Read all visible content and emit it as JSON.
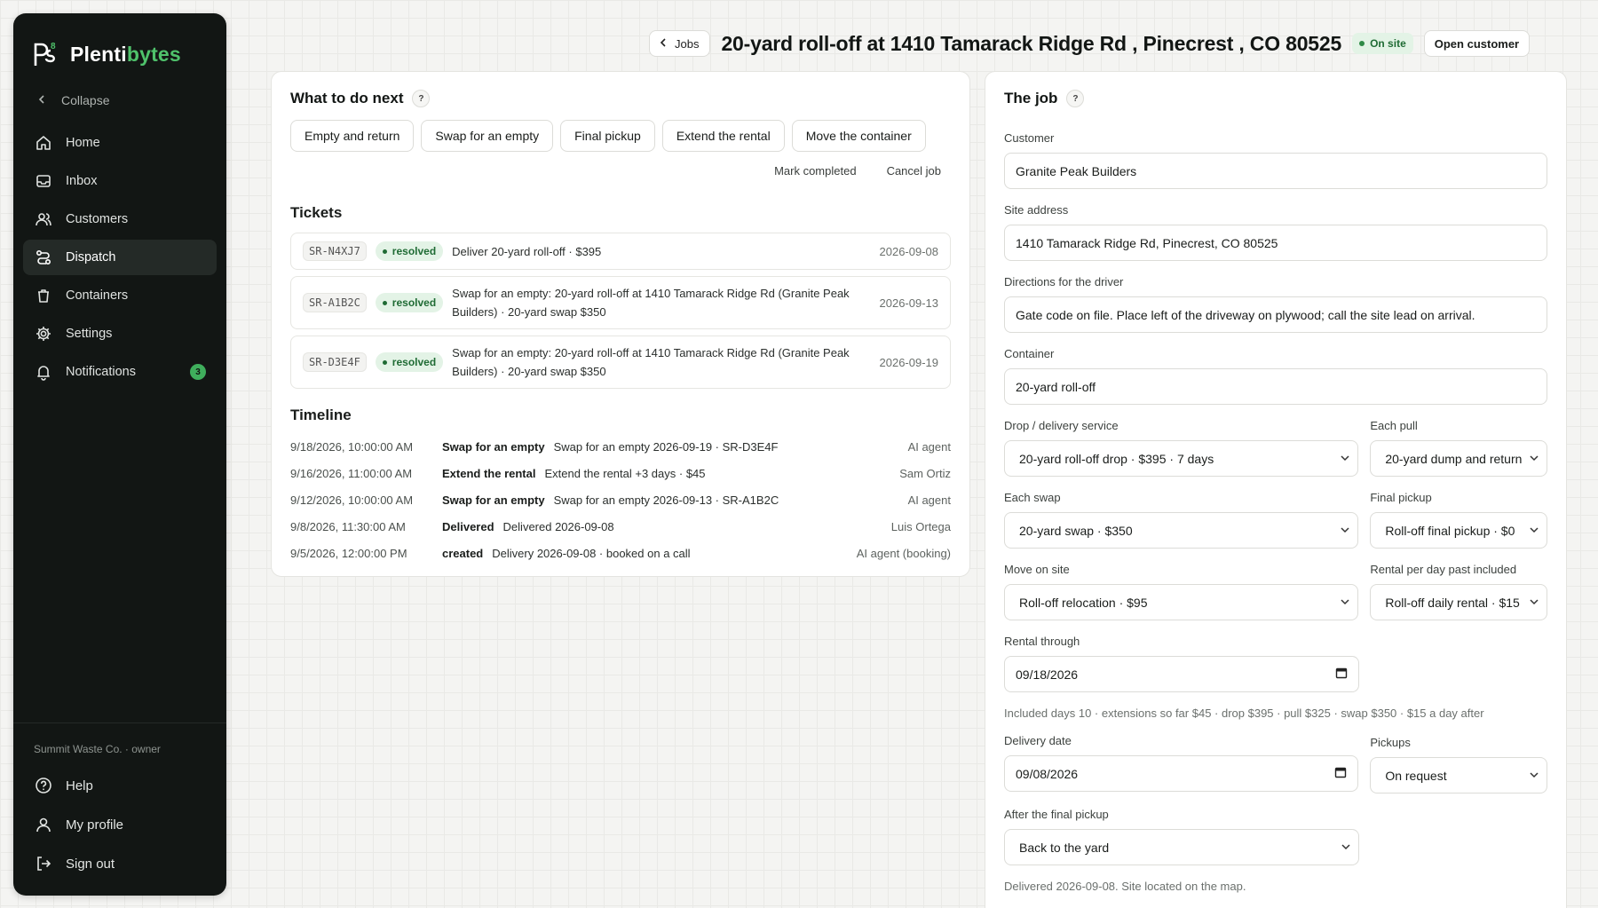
{
  "brand": {
    "prefix": "Plenti",
    "accent": "bytes",
    "accent_color": "#4fc26b"
  },
  "sidebar": {
    "collapse_label": "Collapse",
    "items": [
      {
        "label": "Home",
        "icon": "home-icon"
      },
      {
        "label": "Inbox",
        "icon": "inbox-icon"
      },
      {
        "label": "Customers",
        "icon": "users-icon"
      },
      {
        "label": "Dispatch",
        "icon": "route-icon",
        "active": true
      },
      {
        "label": "Containers",
        "icon": "trash-icon"
      },
      {
        "label": "Settings",
        "icon": "gear-icon"
      },
      {
        "label": "Notifications",
        "icon": "bell-icon",
        "badge": "3"
      }
    ],
    "org_label": "Summit Waste Co. · owner",
    "bottom": [
      {
        "label": "Help",
        "icon": "help-icon"
      },
      {
        "label": "My profile",
        "icon": "user-icon"
      },
      {
        "label": "Sign out",
        "icon": "sign-out-icon"
      }
    ]
  },
  "header": {
    "back_label": "Jobs",
    "title": "20-yard roll-off at 1410 Tamarack Ridge Rd , Pinecrest , CO 80525",
    "status": "On site",
    "open_customer_label": "Open customer"
  },
  "next": {
    "title": "What to do next",
    "help": "?",
    "actions": [
      "Empty and return",
      "Swap for an empty",
      "Final pickup",
      "Extend the rental",
      "Move the container"
    ],
    "mark_completed": "Mark completed",
    "cancel_job": "Cancel job"
  },
  "tickets": {
    "title": "Tickets",
    "rows": [
      {
        "code": "SR-N4XJ7",
        "status": "resolved",
        "desc": "Deliver 20-yard roll-off · $395",
        "date": "2026-09-08"
      },
      {
        "code": "SR-A1B2C",
        "status": "resolved",
        "desc": "Swap for an empty: 20-yard roll-off at 1410 Tamarack Ridge Rd (Granite Peak Builders) · 20-yard swap $350",
        "date": "2026-09-13"
      },
      {
        "code": "SR-D3E4F",
        "status": "resolved",
        "desc": "Swap for an empty: 20-yard roll-off at 1410 Tamarack Ridge Rd (Granite Peak Builders) · 20-yard swap $350",
        "date": "2026-09-19"
      }
    ]
  },
  "timeline": {
    "title": "Timeline",
    "rows": [
      {
        "time": "9/18/2026, 10:00:00 AM",
        "kind": "Swap for an empty",
        "text": "Swap for an empty 2026-09-19 · SR-D3E4F",
        "actor": "AI agent"
      },
      {
        "time": "9/16/2026, 11:00:00 AM",
        "kind": "Extend the rental",
        "text": "Extend the rental +3 days · $45",
        "actor": "Sam Ortiz"
      },
      {
        "time": "9/12/2026, 10:00:00 AM",
        "kind": "Swap for an empty",
        "text": "Swap for an empty 2026-09-13 · SR-A1B2C",
        "actor": "AI agent"
      },
      {
        "time": "9/8/2026, 11:30:00 AM",
        "kind": "Delivered",
        "text": "Delivered 2026-09-08",
        "actor": "Luis Ortega"
      },
      {
        "time": "9/5/2026, 12:00:00 PM",
        "kind": "created",
        "text": "Delivery 2026-09-08 · booked on a call",
        "actor": "AI agent (booking)"
      }
    ]
  },
  "job": {
    "title": "The job",
    "help": "?",
    "customer_label": "Customer",
    "customer": "Granite Peak Builders",
    "site_label": "Site address",
    "site": "1410 Tamarack Ridge Rd, Pinecrest, CO 80525",
    "directions_label": "Directions for the driver",
    "directions": "Gate code on file. Place left of the driveway on plywood; call the site lead on arrival.",
    "container_label": "Container",
    "container": "20-yard roll-off",
    "drop_label": "Drop / delivery service",
    "drop": "20-yard roll-off drop · $395 · 7 days",
    "pull_label": "Each pull",
    "pull": "20-yard dump and return",
    "swap_label": "Each swap",
    "swap": "20-yard swap · $350",
    "final_label": "Final pickup",
    "final": "Roll-off final pickup · $0",
    "move_label": "Move on site",
    "move": "Roll-off relocation · $95",
    "perday_label": "Rental per day past included",
    "perday": "Roll-off daily rental · $15",
    "rental_through_label": "Rental through",
    "rental_through": "09/18/2026",
    "included_note": "Included days 10 · extensions so far $45 · drop $395 · pull $325 · swap $350 · $15 a day after",
    "delivery_label": "Delivery date",
    "delivery": "09/08/2026",
    "pickups_label": "Pickups",
    "pickups": "On request",
    "after_label": "After the final pickup",
    "after": "Back to the yard",
    "delivered_note": "Delivered 2026-09-08. Site located on the map."
  }
}
